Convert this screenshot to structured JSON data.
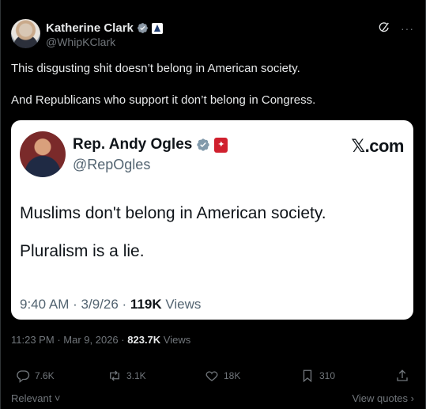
{
  "author": {
    "display_name": "Katherine Clark",
    "handle": "@WhipKClark"
  },
  "tweet": {
    "paragraphs": [
      "This disgusting shit doesn’t belong in American society.",
      "And Republicans who support it don’t belong in Congress."
    ]
  },
  "embed": {
    "display_name": "Rep. Andy Ogles",
    "handle": "@RepOgles",
    "source": "𝕏.com",
    "paragraphs": [
      "Muslims don't belong in American society.",
      "Pluralism is a lie."
    ],
    "time": "9:40 AM",
    "date": "3/9/26",
    "views_count": "119K",
    "views_label": "Views"
  },
  "meta": {
    "time": "11:23 PM",
    "date": "Mar 9, 2026",
    "views_count": "823.7K",
    "views_label": "Views"
  },
  "actions": {
    "replies": "7.6K",
    "reposts": "3.1K",
    "likes": "18K",
    "bookmarks": "310"
  },
  "footer": {
    "sort_label": "Relevant",
    "view_quotes_label": "View quotes"
  },
  "icons": {
    "verified": "verified-icon",
    "grok": "grok-icon",
    "more": "more-icon",
    "reply": "reply-icon",
    "repost": "repost-icon",
    "like": "like-icon",
    "bookmark": "bookmark-icon",
    "share": "share-icon"
  },
  "colors": {
    "background": "#000000",
    "text": "#e7e9ea",
    "muted": "#71767b",
    "verified": "#1d9bf0",
    "embed_bg": "#ffffff",
    "house_badge": "#d0202e"
  }
}
